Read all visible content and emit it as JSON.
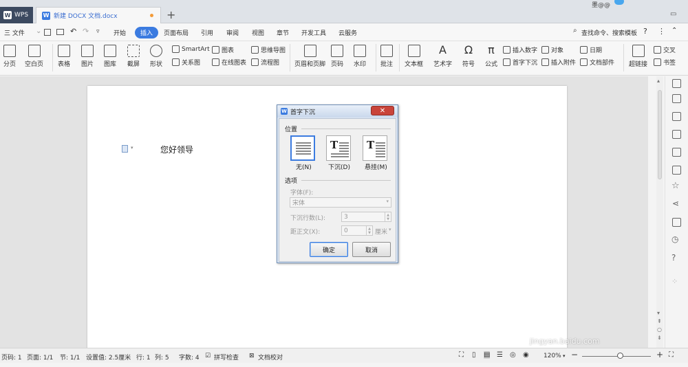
{
  "titlebar": {
    "wps_tab": "WPS",
    "doc_tab": "新建 DOCX 文档.docx",
    "user": "墨@@"
  },
  "menu": {
    "file": "三 文件",
    "items": [
      "开始",
      "插入",
      "页面布局",
      "引用",
      "审阅",
      "视图",
      "章节",
      "开发工具",
      "云服务"
    ],
    "active": "插入",
    "search": "查找命令、搜索模板"
  },
  "ribbon": {
    "page_break": "分页",
    "blank_page": "空白页",
    "table": "表格",
    "picture": "图片",
    "gallery": "图库",
    "screenshot": "截屏",
    "shapes": "形状",
    "smartart": "SmartArt",
    "chart": "图表",
    "mindmap": "思维导图",
    "relation": "关系图",
    "online_chart": "在线图表",
    "flowchart": "流程图",
    "header_footer": "页眉和页脚",
    "page_number": "页码",
    "watermark": "水印",
    "comment": "批注",
    "textbox": "文本框",
    "wordart": "艺术字",
    "symbol": "符号",
    "formula": "公式",
    "insert_number": "插入数字",
    "object": "对象",
    "date": "日期",
    "drop_cap": "首字下沉",
    "attachment": "插入附件",
    "doc_parts": "文档部件",
    "hyperlink": "超链接",
    "crossref": "交叉",
    "bookmark": "书签"
  },
  "document": {
    "text": "您好领导"
  },
  "dialog": {
    "title": "首字下沉",
    "position_label": "位置",
    "positions": [
      "无(N)",
      "下沉(D)",
      "悬挂(M)"
    ],
    "selected_position": "无(N)",
    "options_label": "选项",
    "font_label": "字体(F):",
    "font_value": "宋体",
    "lines_label": "下沉行数(L):",
    "lines_value": "3",
    "distance_label": "距正文(X):",
    "distance_value": "0",
    "distance_unit": "厘米",
    "ok": "确定",
    "cancel": "取消"
  },
  "status": {
    "page_num": "页码: 1",
    "pages": "页面: 1/1",
    "section": "节: 1/1",
    "setting": "设置值: 2.5厘米",
    "row": "行: 1",
    "col": "列: 5",
    "words": "字数: 4",
    "spell": "拼写检查",
    "proof": "文档校对",
    "zoom": "120%"
  },
  "watermark": {
    "logo": "Baidu经验",
    "url": "jingyan.baidu.com"
  }
}
